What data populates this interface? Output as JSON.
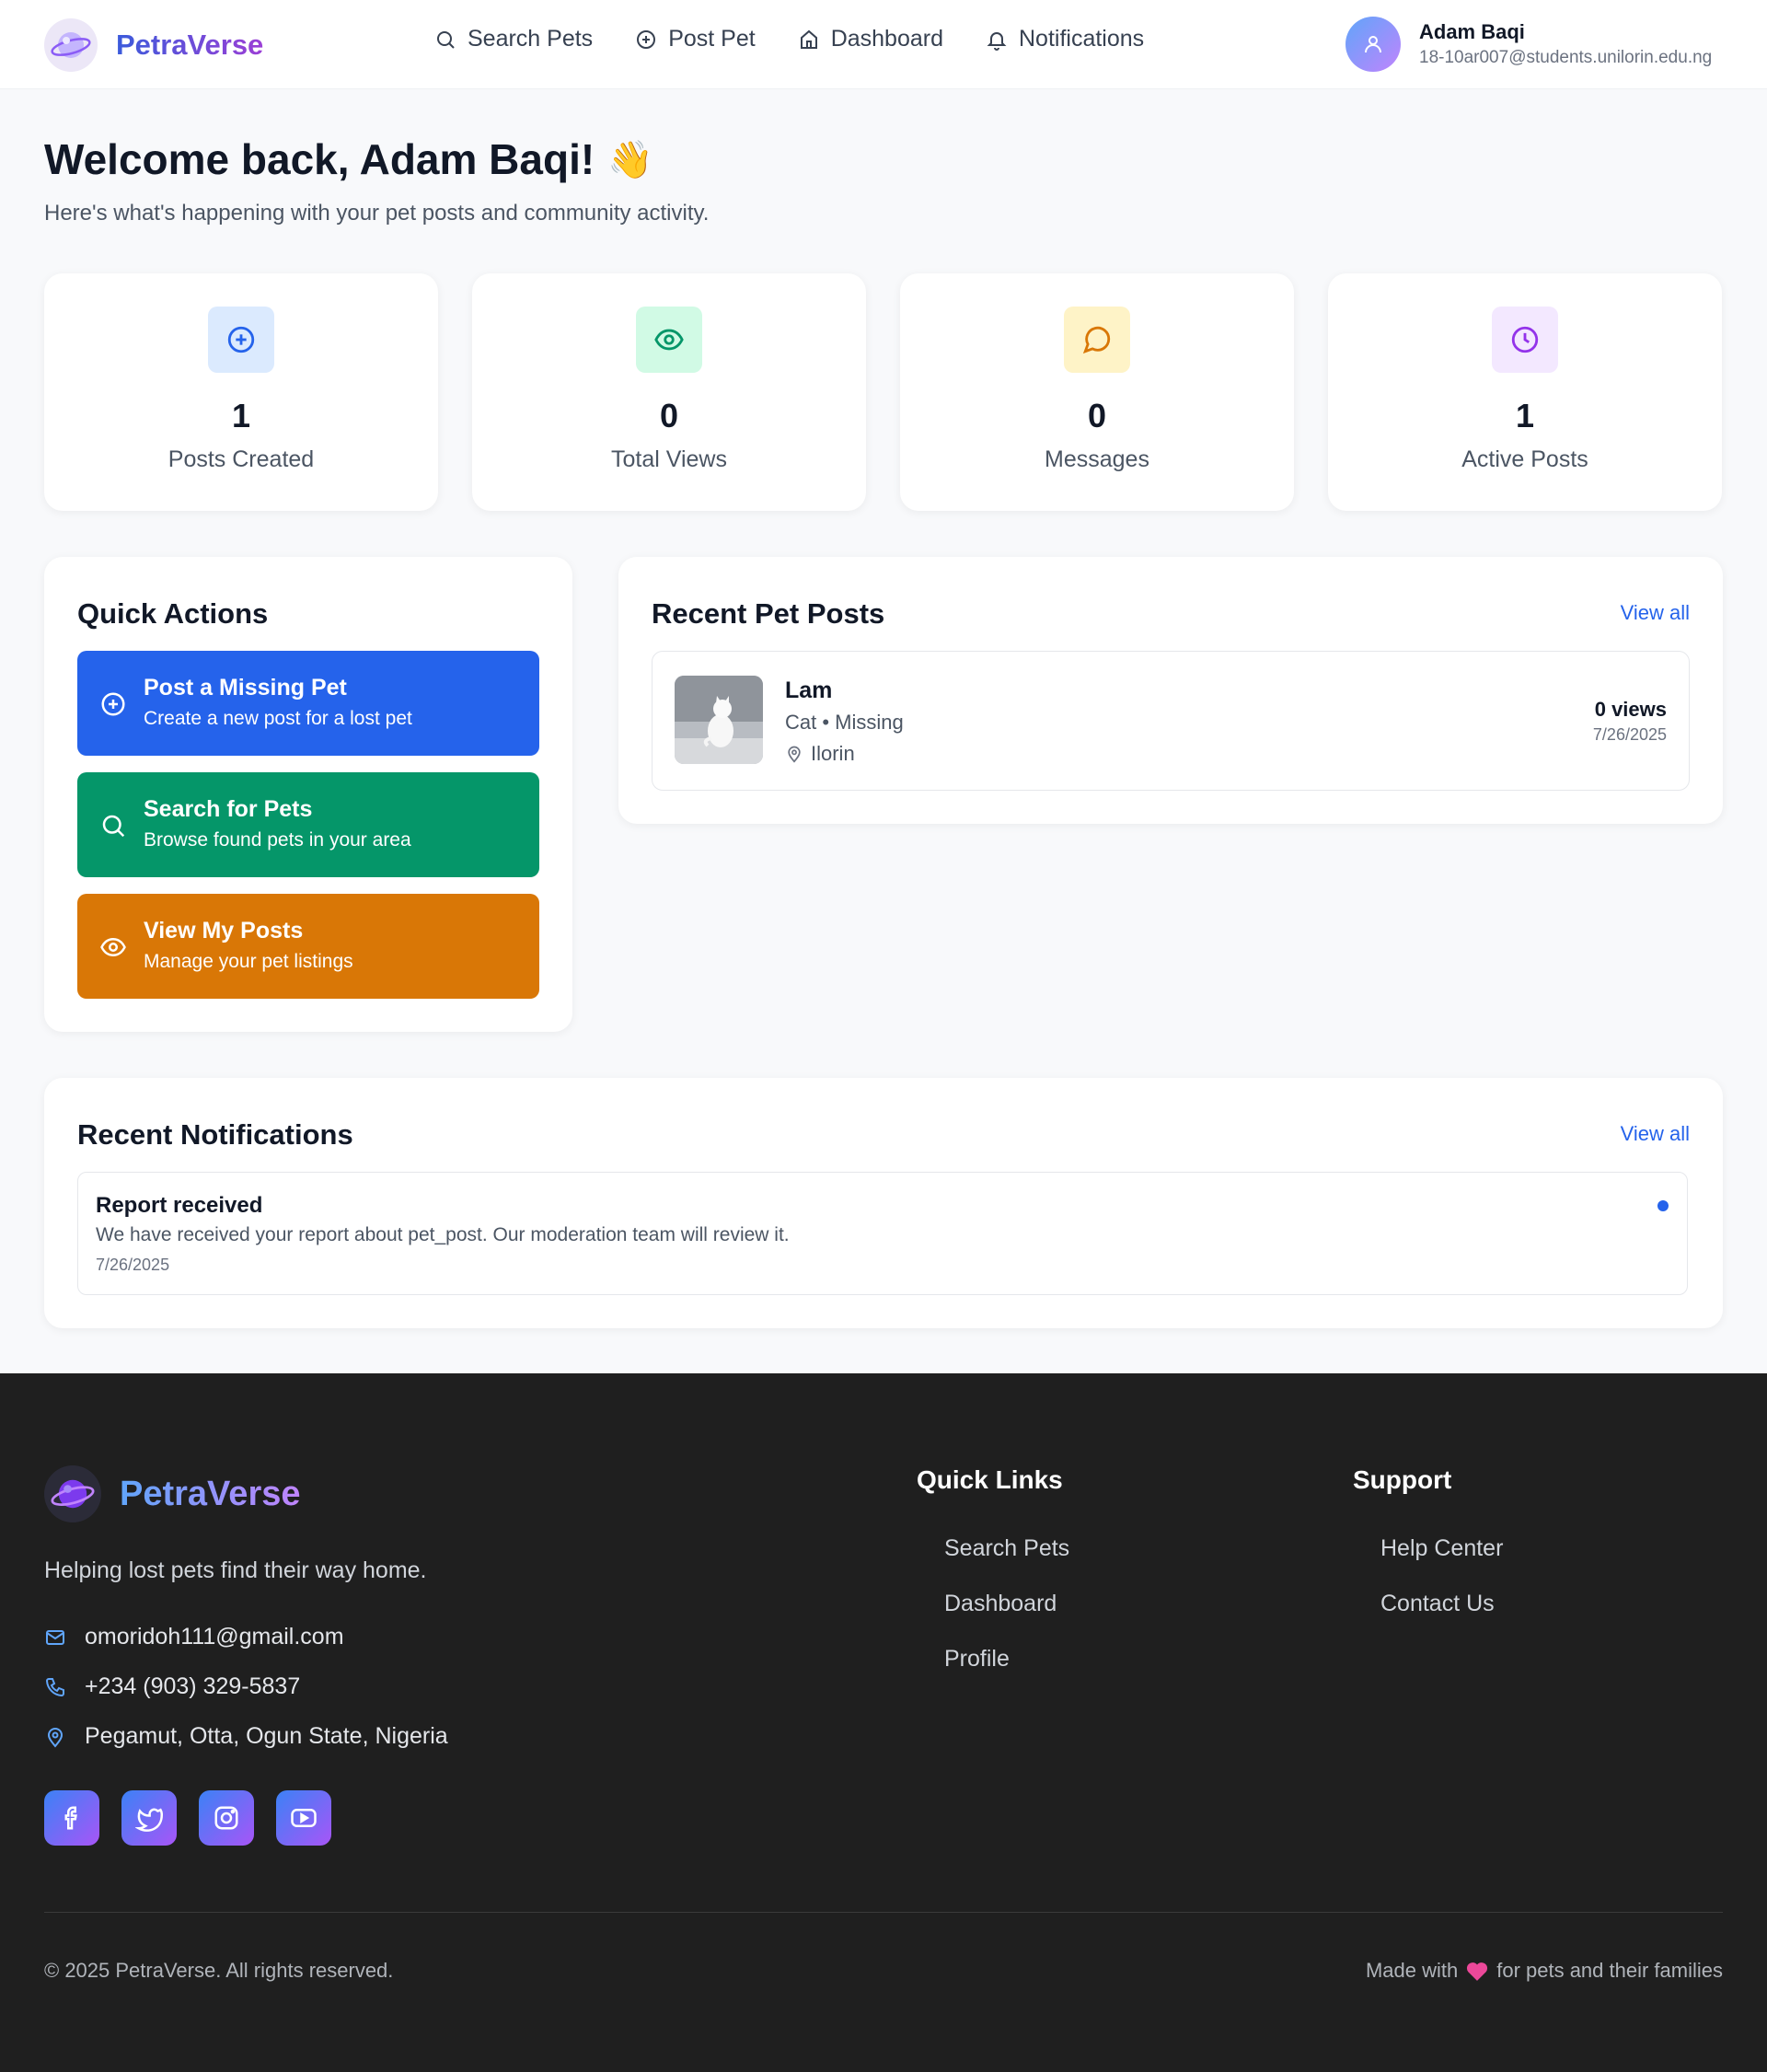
{
  "app": {
    "name": "PetraVerse"
  },
  "nav": [
    {
      "label": "Search Pets",
      "icon": "search-icon"
    },
    {
      "label": "Post Pet",
      "icon": "plus-circle-icon"
    },
    {
      "label": "Dashboard",
      "icon": "home-icon"
    },
    {
      "label": "Notifications",
      "icon": "bell-icon"
    }
  ],
  "user": {
    "name": "Adam Baqi",
    "email": "18-10ar007@students.unilorin.edu.ng"
  },
  "welcome": {
    "title": "Welcome back, Adam Baqi!",
    "emoji": "👋",
    "subtitle": "Here's what's happening with your pet posts and community activity."
  },
  "stats": [
    {
      "value": "1",
      "label": "Posts Created",
      "icon": "plus-circle-icon",
      "color": "#2563eb",
      "bg": "#dbeafe"
    },
    {
      "value": "0",
      "label": "Total Views",
      "icon": "eye-icon",
      "color": "#059669",
      "bg": "#d1fae5"
    },
    {
      "value": "0",
      "label": "Messages",
      "icon": "message-circle-icon",
      "color": "#d97706",
      "bg": "#fef3c7"
    },
    {
      "value": "1",
      "label": "Active Posts",
      "icon": "clock-icon",
      "color": "#9333ea",
      "bg": "#f3e8ff"
    }
  ],
  "quick_actions": {
    "title": "Quick Actions",
    "items": [
      {
        "title": "Post a Missing Pet",
        "subtitle": "Create a new post for a lost pet",
        "icon": "plus-circle-icon",
        "color": "#2563eb"
      },
      {
        "title": "Search for Pets",
        "subtitle": "Browse found pets in your area",
        "icon": "search-icon",
        "color": "#059669"
      },
      {
        "title": "View My Posts",
        "subtitle": "Manage your pet listings",
        "icon": "eye-icon",
        "color": "#d97706"
      }
    ]
  },
  "recent_posts": {
    "title": "Recent Pet Posts",
    "view_all": "View all",
    "items": [
      {
        "name": "Lam",
        "meta": "Cat • Missing",
        "location": "Ilorin",
        "views": "0 views",
        "date": "7/26/2025"
      }
    ]
  },
  "notifications": {
    "title": "Recent Notifications",
    "view_all": "View all",
    "items": [
      {
        "title": "Report received",
        "text": "We have received your report about pet_post. Our moderation team will review it.",
        "date": "7/26/2025"
      }
    ]
  },
  "footer": {
    "logo": "PetraVerse",
    "tagline": "Helping lost pets find their way home.",
    "email": "omoridoh111@gmail.com",
    "phone": "+234 (903) 329-5837",
    "address": "Pegamut, Otta, Ogun State, Nigeria",
    "socials": [
      "facebook-icon",
      "twitter-icon",
      "instagram-icon",
      "youtube-icon"
    ],
    "quick_links": {
      "title": "Quick Links",
      "items": [
        "Search Pets",
        "Dashboard",
        "Profile"
      ]
    },
    "support": {
      "title": "Support",
      "items": [
        "Help Center",
        "Contact Us"
      ]
    },
    "copyright": "© 2025 PetraVerse. All rights reserved.",
    "made_with_prefix": "Made with",
    "made_with_suffix": "for pets and their families"
  }
}
